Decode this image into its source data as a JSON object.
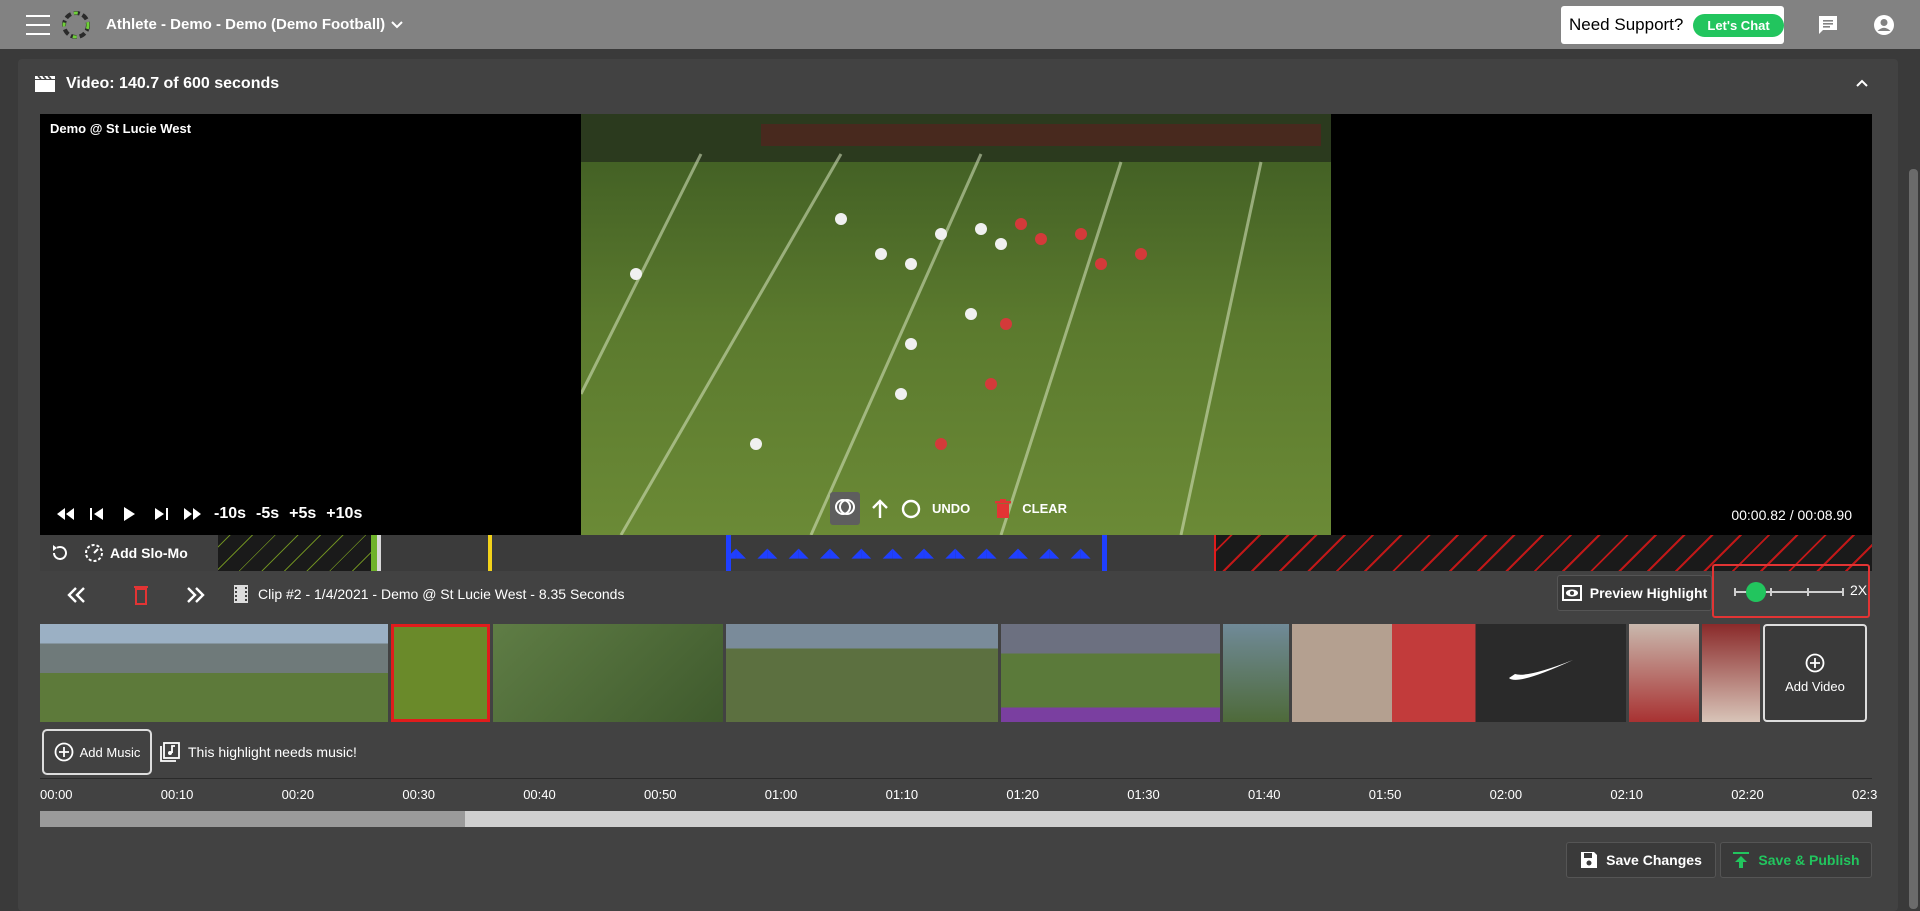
{
  "topbar": {
    "app_title": "Athlete - Demo - Demo (Demo Football)",
    "support_text": "Need Support?",
    "chat_label": "Let's Chat"
  },
  "card": {
    "video_header": "Video: 140.7 of 600 seconds"
  },
  "video": {
    "overlay_title": "Demo @ St Lucie West",
    "skip_back_10": "-10s",
    "skip_back_5": "-5s",
    "skip_fwd_5": "+5s",
    "skip_fwd_10": "+10s",
    "undo_label": "UNDO",
    "clear_label": "CLEAR",
    "time_readout": "00:00.82 / 00:08.90"
  },
  "strip": {
    "slomo_label": "Add Slo-Mo"
  },
  "clip": {
    "title": "Clip #2 - 1/4/2021 - Demo @ St Lucie West - 8.35 Seconds",
    "preview_label": "Preview Highlight",
    "speed_label": "2X",
    "speed_value_fraction": 0.2
  },
  "thumbnails": {
    "add_video_label": "Add Video"
  },
  "music": {
    "add_music_label": "Add Music",
    "notice": "This highlight needs music!"
  },
  "ruler": {
    "labels": [
      "00:00",
      "00:10",
      "00:20",
      "00:30",
      "00:40",
      "00:50",
      "01:00",
      "01:10",
      "01:20",
      "01:30",
      "01:40",
      "01:50",
      "02:00",
      "02:10",
      "02:20",
      "02:3"
    ],
    "progress_fraction": 0.232
  },
  "actions": {
    "save_label": "Save Changes",
    "publish_label": "Save & Publish"
  },
  "colors": {
    "accent_green": "#22c55e",
    "danger_red": "#e23434",
    "topbar": "#828282",
    "slomo_blue": "#1f3fff"
  }
}
